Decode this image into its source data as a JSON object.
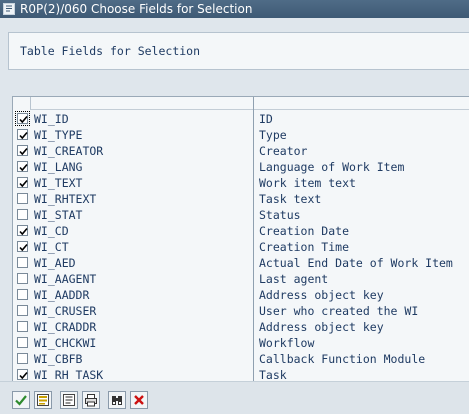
{
  "window": {
    "title": "R0P(2)/060 Choose Fields for Selection"
  },
  "header": {
    "label": "Table Fields for Selection"
  },
  "fields": [
    {
      "name": "WI_ID",
      "desc": "ID",
      "checked": true
    },
    {
      "name": "WI_TYPE",
      "desc": "Type",
      "checked": true
    },
    {
      "name": "WI_CREATOR",
      "desc": "Creator",
      "checked": true
    },
    {
      "name": "WI_LANG",
      "desc": "Language of Work Item",
      "checked": true
    },
    {
      "name": "WI_TEXT",
      "desc": "Work item text",
      "checked": true
    },
    {
      "name": "WI_RHTEXT",
      "desc": "Task text",
      "checked": false
    },
    {
      "name": "WI_STAT",
      "desc": "Status",
      "checked": false
    },
    {
      "name": "WI_CD",
      "desc": "Creation Date",
      "checked": true
    },
    {
      "name": "WI_CT",
      "desc": "Creation Time",
      "checked": true
    },
    {
      "name": "WI_AED",
      "desc": "Actual End Date of Work Item",
      "checked": false
    },
    {
      "name": "WI_AAGENT",
      "desc": "Last agent",
      "checked": false
    },
    {
      "name": "WI_AADDR",
      "desc": "Address object key",
      "checked": false
    },
    {
      "name": "WI_CRUSER",
      "desc": "User who created the WI",
      "checked": false
    },
    {
      "name": "WI_CRADDR",
      "desc": "Address object key",
      "checked": false
    },
    {
      "name": "WI_CHCKWI",
      "desc": "Workflow",
      "checked": false
    },
    {
      "name": "WI_CBFB",
      "desc": "Callback Function Module",
      "checked": false
    },
    {
      "name": "WI_RH_TASK",
      "desc": "Task",
      "checked": true
    }
  ],
  "toolbar": {
    "buttons": [
      {
        "name": "continue-button",
        "icon": "checkmark-icon",
        "color": "#2e8b2e"
      },
      {
        "name": "select-all-button",
        "icon": "select-all-icon",
        "color": "#c9a000"
      },
      {
        "name": "deselect-all-button",
        "icon": "deselect-all-icon",
        "color": "#555555"
      },
      {
        "name": "print-button",
        "icon": "printer-icon",
        "color": "#333333"
      },
      {
        "name": "find-button",
        "icon": "binoculars-icon",
        "color": "#333333"
      },
      {
        "name": "cancel-button",
        "icon": "close-icon",
        "color": "#cc1111"
      }
    ]
  }
}
